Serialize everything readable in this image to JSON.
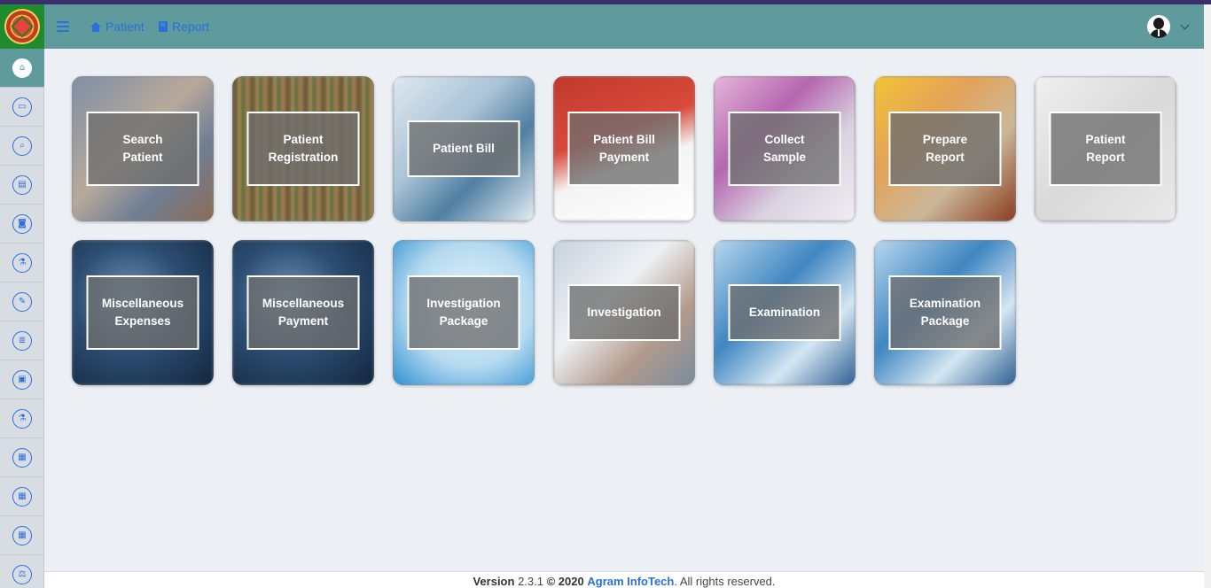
{
  "header": {
    "nav": [
      {
        "label": "Patient",
        "icon": "home-icon"
      },
      {
        "label": "Report",
        "icon": "book-icon"
      }
    ]
  },
  "sidebar": {
    "items": [
      {
        "icon": "home-icon",
        "glyph": "⌂",
        "active": true
      },
      {
        "icon": "bed-icon",
        "glyph": "▭"
      },
      {
        "icon": "search-icon",
        "glyph": "⌕"
      },
      {
        "icon": "book-icon",
        "glyph": "▤"
      },
      {
        "icon": "camera-icon",
        "glyph": "◙"
      },
      {
        "icon": "flask-icon",
        "glyph": "⚗"
      },
      {
        "icon": "edit-icon",
        "glyph": "✎"
      },
      {
        "icon": "list-icon",
        "glyph": "≣"
      },
      {
        "icon": "image-icon",
        "glyph": "▣"
      },
      {
        "icon": "flask-icon",
        "glyph": "⚗"
      },
      {
        "icon": "grid-icon",
        "glyph": "▦"
      },
      {
        "icon": "grid-icon",
        "glyph": "▦"
      },
      {
        "icon": "grid-icon",
        "glyph": "▦"
      },
      {
        "icon": "scale-icon",
        "glyph": "⚖"
      }
    ]
  },
  "tiles": [
    {
      "lines": [
        "Search",
        "Patient"
      ],
      "bg": "linear-gradient(135deg,#7d8fa6 0%,#b9a99a 45%,#6f7f95 70%,#8c6b55 100%)"
    },
    {
      "lines": [
        "Patient",
        "Registration"
      ],
      "bg": "repeating-linear-gradient(90deg,#6b5a3a 0 6px,#a48b56 6px 10px,#5c6b41 10px 14px,#9b7a4d 14px 20px)"
    },
    {
      "lines": [
        "Patient Bill"
      ],
      "bg": "linear-gradient(135deg,#dfe8ef 0%,#a9c3d6 40%,#4f7fa2 65%,#e6eef4 100%)"
    },
    {
      "lines": [
        "Patient Bill",
        "Payment"
      ],
      "bg": "linear-gradient(160deg,#c0392b 0%,#d84a3c 40%,#f4f4f4 60%,#ffffff 100%)"
    },
    {
      "lines": [
        "Collect",
        "Sample"
      ],
      "bg": "linear-gradient(135deg,#e6b7d9 0%,#b566b0 35%,#d9d2e0 65%,#f2eef3 100%)"
    },
    {
      "lines": [
        "Prepare",
        "Report"
      ],
      "bg": "linear-gradient(135deg,#f3c437 0%,#e3a25a 35%,#cbb89a 65%,#8a3b1f 100%)"
    },
    {
      "lines": [
        "Patient",
        "Report"
      ],
      "bg": "linear-gradient(135deg,#f0f0f0 0%,#d9d9d9 50%,#eaeaea 100%)"
    },
    {
      "lines": [
        "Miscellaneous",
        "Expenses"
      ],
      "bg": "radial-gradient(circle at 40% 40%,#6f93b8 0%,#2c4d72 45%,#12263e 100%)"
    },
    {
      "lines": [
        "Miscellaneous",
        "Payment"
      ],
      "bg": "radial-gradient(circle at 40% 40%,#6f93b8 0%,#2c4d72 45%,#12263e 100%)"
    },
    {
      "lines": [
        "Investigation",
        "Package"
      ],
      "bg": "radial-gradient(circle at 55% 45%,#e9f4fb 0%,#b5daf0 55%,#2f8fd1 100%)"
    },
    {
      "lines": [
        "Investigation"
      ],
      "bg": "linear-gradient(135deg,#c7d2dc 0%,#eef1f4 40%,#b39b8c 70%,#7b8c9e 100%)"
    },
    {
      "lines": [
        "Examination"
      ],
      "bg": "linear-gradient(135deg,#b9d8ee 0%,#3f86c1 40%,#d5e7f3 70%,#2d5f93 100%)"
    },
    {
      "lines": [
        "Examination",
        "Package"
      ],
      "bg": "linear-gradient(135deg,#b9d8ee 0%,#3f86c1 40%,#d5e7f3 70%,#2d5f93 100%)"
    }
  ],
  "footer": {
    "version_label": "Version",
    "version_number": "2.3.1",
    "copyright": "© 2020",
    "company": "Agram InfoTech",
    "rights": ". All rights reserved."
  }
}
